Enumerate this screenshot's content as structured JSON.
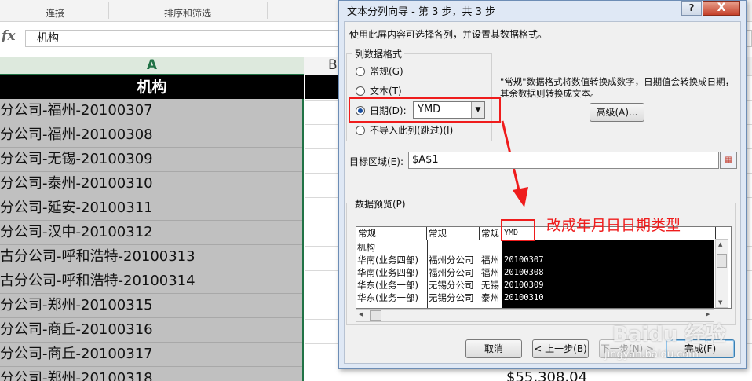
{
  "ribbon": {
    "group_connect": "连接",
    "group_sort_filter": "排序和筛选"
  },
  "formula_bar": {
    "fx_label": "fx",
    "value": "机构"
  },
  "columns": {
    "col_a": "A",
    "col_b": "B"
  },
  "sheet": {
    "header": "机构",
    "rows": [
      "分公司-福州-20100307",
      "分公司-福州-20100308",
      "分公司-无锡-20100309",
      "分公司-泰州-20100310",
      "分公司-延安-20100311",
      "分公司-汉中-20100312",
      "古分公司-呼和浩特-20100313",
      "古分公司-呼和浩特-20100314",
      "分公司-郑州-20100315",
      "分公司-商丘-20100316",
      "分公司-商丘-20100317",
      "分公司-郑州-20100318"
    ],
    "money_value": "$55,308.04"
  },
  "dialog": {
    "title": "文本分列向导 - 第 3 步，共 3 步",
    "help_label": "?",
    "close_label": "X",
    "instruction": "使用此屏内容可选择各列，并设置其数据格式。",
    "format_group_label": "列数据格式",
    "radio_general": "常规(G)",
    "radio_text": "文本(T)",
    "radio_date": "日期(D):",
    "radio_skip": "不导入此列(跳过)(I)",
    "selected_format": "日期",
    "date_format_value": "YMD",
    "description": "\"常规\"数据格式将数值转换成数字，日期值会转换成日期，其余数据则转换成文本。",
    "advanced_button": "高级(A)...",
    "destination_label": "目标区域(E):",
    "destination_value": "$A$1",
    "preview_group_label": "数据预览(P)",
    "preview": {
      "headers": [
        "常规",
        "常规",
        "常规",
        "YMD"
      ],
      "rows": [
        [
          "机构",
          "",
          "",
          ""
        ],
        [
          "华南(业务四部)",
          "福州分公司",
          "福州",
          "20100307"
        ],
        [
          "华南(业务四部)",
          "福州分公司",
          "福州",
          "20100308"
        ],
        [
          "华东(业务一部)",
          "无锡分公司",
          "无锡",
          "20100309"
        ],
        [
          "华东(业务一部)",
          "无锡分公司",
          "泰州",
          "20100310"
        ]
      ]
    },
    "buttons": {
      "cancel": "取消",
      "back": "< 上一步(B)",
      "next": "下一步(N) >",
      "finish": "完成(F)"
    }
  },
  "annotation": {
    "text": "改成年月日日期类型",
    "color": "#ef1c1c"
  },
  "watermark": {
    "brand": "Baidu 经验",
    "url": "jingyan.baidu.com"
  },
  "colors": {
    "excel_green": "#217346",
    "selected_gray": "#c0c0c0",
    "dialog_frame": "#dfe8f5"
  }
}
